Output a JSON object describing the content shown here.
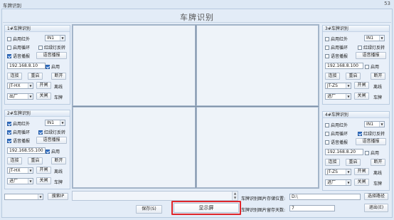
{
  "window": {
    "title": "车牌识别",
    "close_glyph": "53"
  },
  "app_title": "车牌识别",
  "panels": [
    {
      "header": "1#车牌识别",
      "infrared": {
        "label": "启用红外",
        "checked": false
      },
      "input_select": "IN1",
      "loop": {
        "label": "启用循环",
        "checked": false
      },
      "traffic": {
        "label": "红绿灯反转",
        "checked": false
      },
      "voice": {
        "label": "语音播报",
        "checked": true
      },
      "voice_button": "语音播报",
      "ip": "192.168.8.10",
      "enable": {
        "label": "启用",
        "checked": true
      },
      "connect": "连接",
      "restart": "重启",
      "disconnect": "断开",
      "camera_model": "JT-HX",
      "open_gate": "开闸",
      "status": "离线",
      "direction": "出厂",
      "close_gate": "关闸",
      "plate_label": "车牌"
    },
    {
      "header": "2#车牌识别",
      "infrared": {
        "label": "启用红外",
        "checked": true
      },
      "input_select": "IN1",
      "loop": {
        "label": "启用循环",
        "checked": true
      },
      "traffic": {
        "label": "红绿灯反转",
        "checked": true
      },
      "voice": {
        "label": "语音播报",
        "checked": true
      },
      "voice_button": "语音播报",
      "ip": "192.168.55.100",
      "enable": {
        "label": "启用",
        "checked": true
      },
      "connect": "连接",
      "restart": "重启",
      "disconnect": "断开",
      "camera_model": "JT-HX",
      "open_gate": "开闸",
      "status": "离线",
      "direction": "进厂",
      "close_gate": "关闸",
      "plate_label": "车牌"
    },
    {
      "header": "3#车牌识别",
      "infrared": {
        "label": "启用红外",
        "checked": false
      },
      "input_select": "IN1",
      "loop": {
        "label": "启用循环",
        "checked": false
      },
      "traffic": {
        "label": "红绿灯反转",
        "checked": false
      },
      "voice": {
        "label": "语音播报",
        "checked": false
      },
      "voice_button": "语音播报",
      "ip": "192.168.8.100",
      "enable": {
        "label": "启用",
        "checked": false
      },
      "connect": "连接",
      "restart": "重启",
      "disconnect": "断开",
      "camera_model": "JT-ZS",
      "open_gate": "开闸",
      "status": "离线",
      "direction": "进厂",
      "close_gate": "关闸",
      "plate_label": "车牌"
    },
    {
      "header": "4#车牌识别",
      "infrared": {
        "label": "启用红外",
        "checked": false
      },
      "input_select": "IN1",
      "loop": {
        "label": "启用循环",
        "checked": false
      },
      "traffic": {
        "label": "红绿灯反转",
        "checked": true
      },
      "voice": {
        "label": "语音播报",
        "checked": false
      },
      "voice_button": "语音播报",
      "ip": "192.168.8.20",
      "enable": {
        "label": "启用",
        "checked": false
      },
      "connect": "连接",
      "restart": "重启",
      "disconnect": "断开",
      "camera_model": "JT-ZS",
      "open_gate": "开闸",
      "status": "离线",
      "direction": "进厂",
      "close_gate": "关闸",
      "plate_label": "车牌"
    }
  ],
  "bottom": {
    "search_select": "",
    "search_button": "搜索IP",
    "save_button": "保存(S)",
    "display_button": "显示屏",
    "storage_label": "车牌识别图片存储位置:",
    "storage_path": "D:\\",
    "choose_path_button": "选择路径",
    "keep_days_label": "车牌识别图片留存天数:",
    "keep_days": "7",
    "exit_button": "退出(E)"
  },
  "colors": {
    "highlight": "#e0262b",
    "checkbox_on": "#2f6fc7"
  }
}
